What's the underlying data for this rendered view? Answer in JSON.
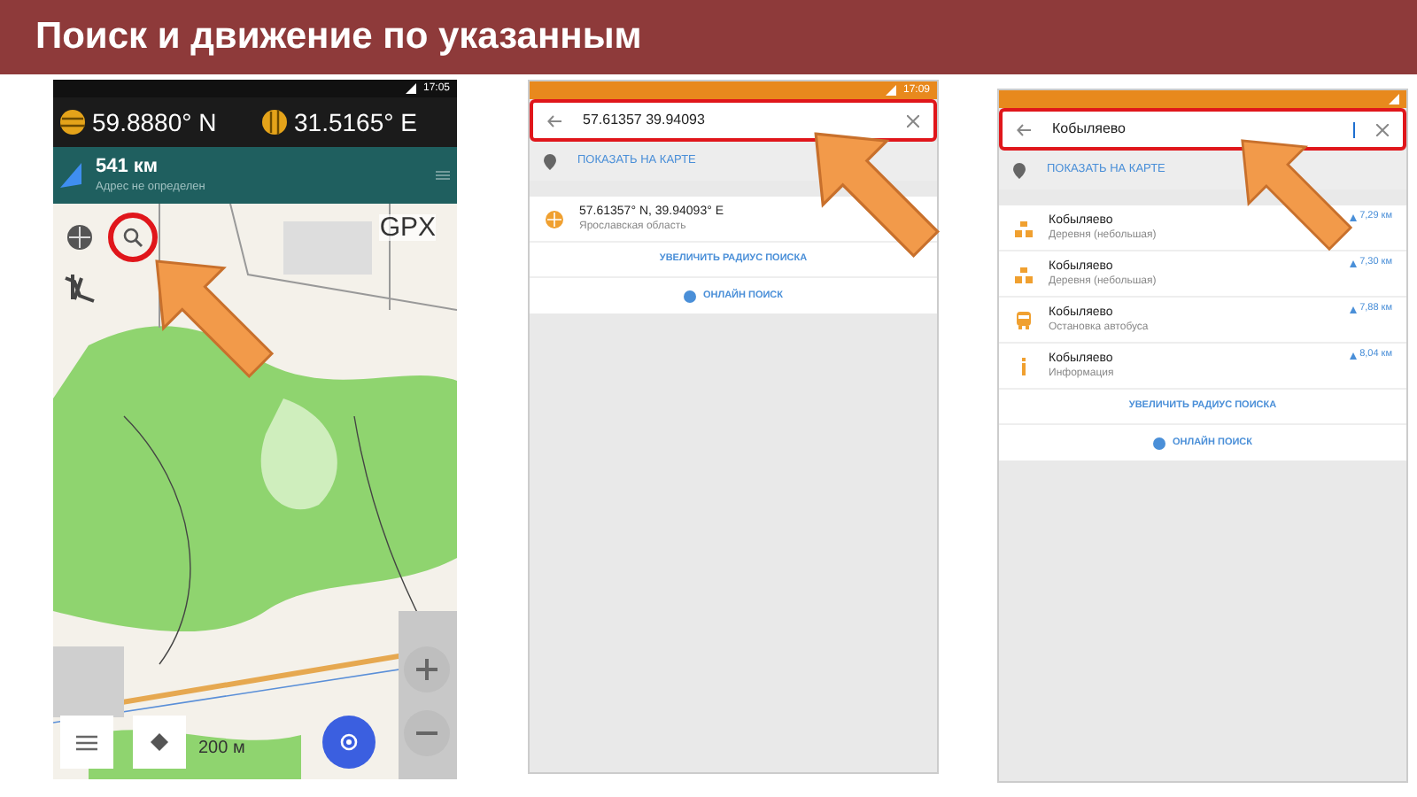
{
  "title": "Поиск и движение по указанным",
  "phones": [
    {
      "kind": "map",
      "time": "17:05",
      "lat": "59.8880° N",
      "lon": "31.5165° E",
      "distance": "541 км",
      "address": "Адрес не определен",
      "gpx": "GPX",
      "scale": "200 м"
    },
    {
      "kind": "search",
      "time": "17:09",
      "query": "57.61357 39.94093",
      "cursor": false,
      "show_on_map": "ПОКАЗАТЬ НА КАРТЕ",
      "results": [
        {
          "kind": "coordinates",
          "name": "57.61357° N, 39.94093° E",
          "detail": "Ярославская область"
        }
      ],
      "expand": "УВЕЛИЧИТЬ РАДИУС ПОИСКА",
      "online": "ОНЛАЙН ПОИСК"
    },
    {
      "kind": "search",
      "query": "Кобыляево",
      "cursor": true,
      "show_on_map": "ПОКАЗАТЬ НА КАРТЕ",
      "results": [
        {
          "kind": "village",
          "name": "Кобыляево",
          "detail": "Деревня (небольшая)",
          "distance": "7,29 км"
        },
        {
          "kind": "village",
          "name": "Кобыляево",
          "detail": "Деревня (небольшая)",
          "distance": "7,30 км"
        },
        {
          "kind": "bus",
          "name": "Кобыляево",
          "detail": "Остановка автобуса",
          "distance": "7,88 км"
        },
        {
          "kind": "info",
          "name": "Кобыляево",
          "detail": "Информация",
          "distance": "8,04 км"
        }
      ],
      "expand": "УВЕЛИЧИТЬ РАДИУС ПОИСКА",
      "online": "ОНЛАЙН ПОИСК"
    }
  ]
}
